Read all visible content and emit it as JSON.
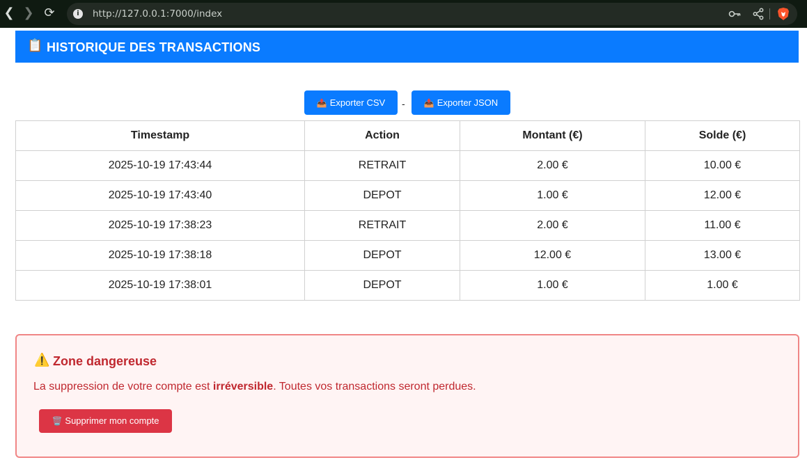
{
  "browser": {
    "url": "http://127.0.0.1:7000/index",
    "back_glyph": "❮",
    "forward_glyph": "❯",
    "reload_glyph": "⟳",
    "info_glyph": "i"
  },
  "header": {
    "icon": "📋",
    "title": "HISTORIQUE DES TRANSACTIONS",
    "color": "#0a7bff"
  },
  "export": {
    "icon": "📤",
    "csv_label": "Exporter CSV",
    "separator": "-",
    "json_label": "Exporter JSON"
  },
  "table": {
    "headers": [
      "Timestamp",
      "Action",
      "Montant (€)",
      "Solde (€)"
    ],
    "rows": [
      [
        "2025-10-19 17:43:44",
        "RETRAIT",
        "2.00 €",
        "10.00 €"
      ],
      [
        "2025-10-19 17:43:40",
        "DEPOT",
        "1.00 €",
        "12.00 €"
      ],
      [
        "2025-10-19 17:38:23",
        "RETRAIT",
        "2.00 €",
        "11.00 €"
      ],
      [
        "2025-10-19 17:38:18",
        "DEPOT",
        "12.00 €",
        "13.00 €"
      ],
      [
        "2025-10-19 17:38:01",
        "DEPOT",
        "1.00 €",
        "1.00 €"
      ]
    ]
  },
  "danger": {
    "icon": "⚠️",
    "title": "Zone dangereuse",
    "text_before": "La suppression de votre compte est ",
    "text_bold": "irréversible",
    "text_after": ". Toutes vos transactions seront perdues.",
    "delete_icon": "🗑️",
    "delete_label": "Supprimer mon compte",
    "color": "#c0282f",
    "button_color": "#dc3545"
  }
}
